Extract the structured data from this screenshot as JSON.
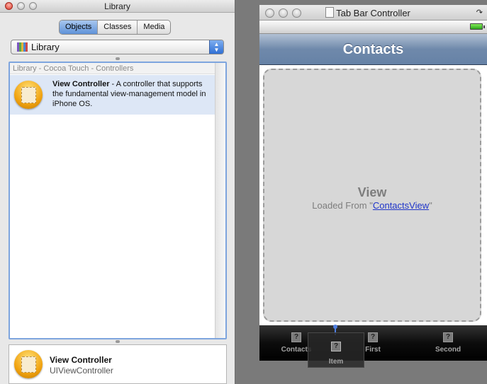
{
  "library": {
    "window_title": "Library",
    "tabs": [
      {
        "label": "Objects",
        "active": true
      },
      {
        "label": "Classes",
        "active": false
      },
      {
        "label": "Media",
        "active": false
      }
    ],
    "popup_label": "Library",
    "list_header": "Library - Cocoa Touch - Controllers",
    "item": {
      "name": "View Controller",
      "description": " - A controller that supports the fundamental view-management model in iPhone OS."
    },
    "detail": {
      "name": "View Controller",
      "class": "UIViewController"
    }
  },
  "tbc": {
    "window_title": "Tab Bar Controller",
    "nav_title": "Contacts",
    "view_title": "View",
    "loaded_prefix": "Loaded From \"",
    "loaded_link": "ContactsView",
    "loaded_suffix": "\"",
    "tabs": [
      {
        "label": "Contacts"
      },
      {
        "label": "First"
      },
      {
        "label": "Second"
      }
    ],
    "drag_item": {
      "label": "Item"
    },
    "tab_icon_glyph": "?"
  },
  "colors": {
    "selection": "#dde7f6",
    "nav_bar": "#6f89ab",
    "link": "#1f35c9"
  }
}
